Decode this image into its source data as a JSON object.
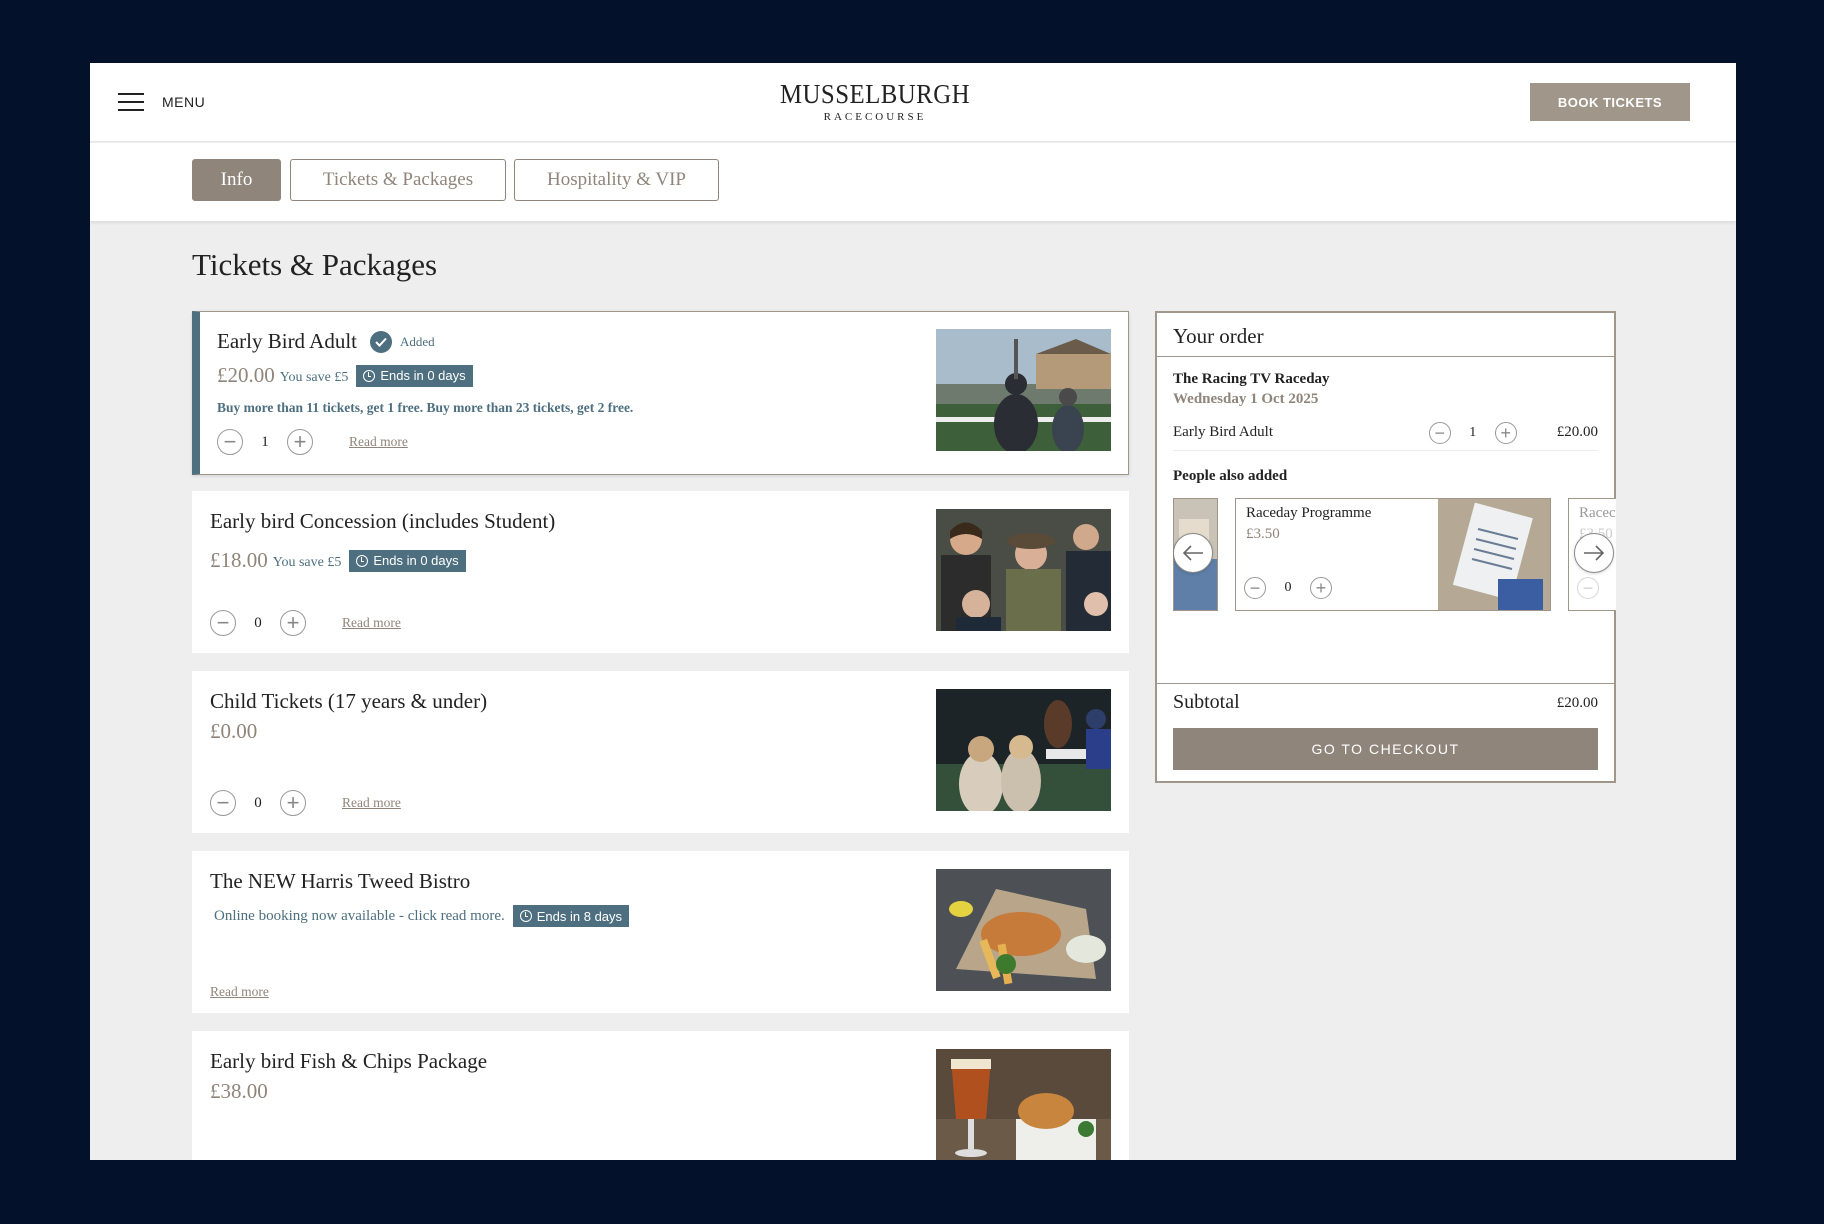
{
  "header": {
    "menu_label": "MENU",
    "logo_main": "MUSSELBURGH",
    "logo_sub": "RACECOURSE",
    "book_label": "BOOK TICKETS"
  },
  "tabs": [
    {
      "label": "Info",
      "active": true
    },
    {
      "label": "Tickets & Packages",
      "active": false
    },
    {
      "label": "Hospitality & VIP",
      "active": false
    }
  ],
  "page_title": "Tickets & Packages",
  "products": [
    {
      "name": "Early Bird Adult",
      "added_label": "Added",
      "price": "£20.00",
      "save": "You save £5",
      "ends": "Ends in 0 days",
      "promo": "Buy more than 11 tickets, get 1 free. Buy more than 23 tickets, get 2 free.",
      "qty": "1",
      "read_more": "Read more",
      "image": "racecourse-crowd-photo"
    },
    {
      "name": "Early bird Concession (includes Student)",
      "price": "£18.00",
      "save": "You save £5",
      "ends": "Ends in 0 days",
      "qty": "0",
      "read_more": "Read more",
      "image": "spectators-cheering-photo"
    },
    {
      "name": "Child Tickets (17 years & under)",
      "price": "£0.00",
      "qty": "0",
      "read_more": "Read more",
      "image": "children-with-horse-photo"
    },
    {
      "name": "The NEW Harris Tweed Bistro",
      "online": "Online booking now available - click read more.",
      "ends": "Ends in 8 days",
      "read_more": "Read more",
      "image": "fish-and-chips-photo"
    },
    {
      "name": "Early bird Fish & Chips Package",
      "price": "£38.00",
      "image": "beer-and-fish-photo"
    }
  ],
  "order": {
    "title": "Your order",
    "event_name": "The Racing TV Raceday",
    "event_date": "Wednesday 1 Oct 2025",
    "line": {
      "name": "Early Bird Adult",
      "qty": "1",
      "price": "£20.00"
    },
    "also_title": "People also added",
    "suggestion": {
      "name": "Raceday Programme",
      "price": "£3.50",
      "qty": "0"
    },
    "next_partial": {
      "name": "Racec",
      "price": "£3.50"
    },
    "subtotal_label": "Subtotal",
    "subtotal_value": "£20.00",
    "checkout_label": "GO TO CHECKOUT"
  },
  "colors": {
    "accent": "#8f857b",
    "teal": "#4d6f7f",
    "background": "#04112b"
  }
}
